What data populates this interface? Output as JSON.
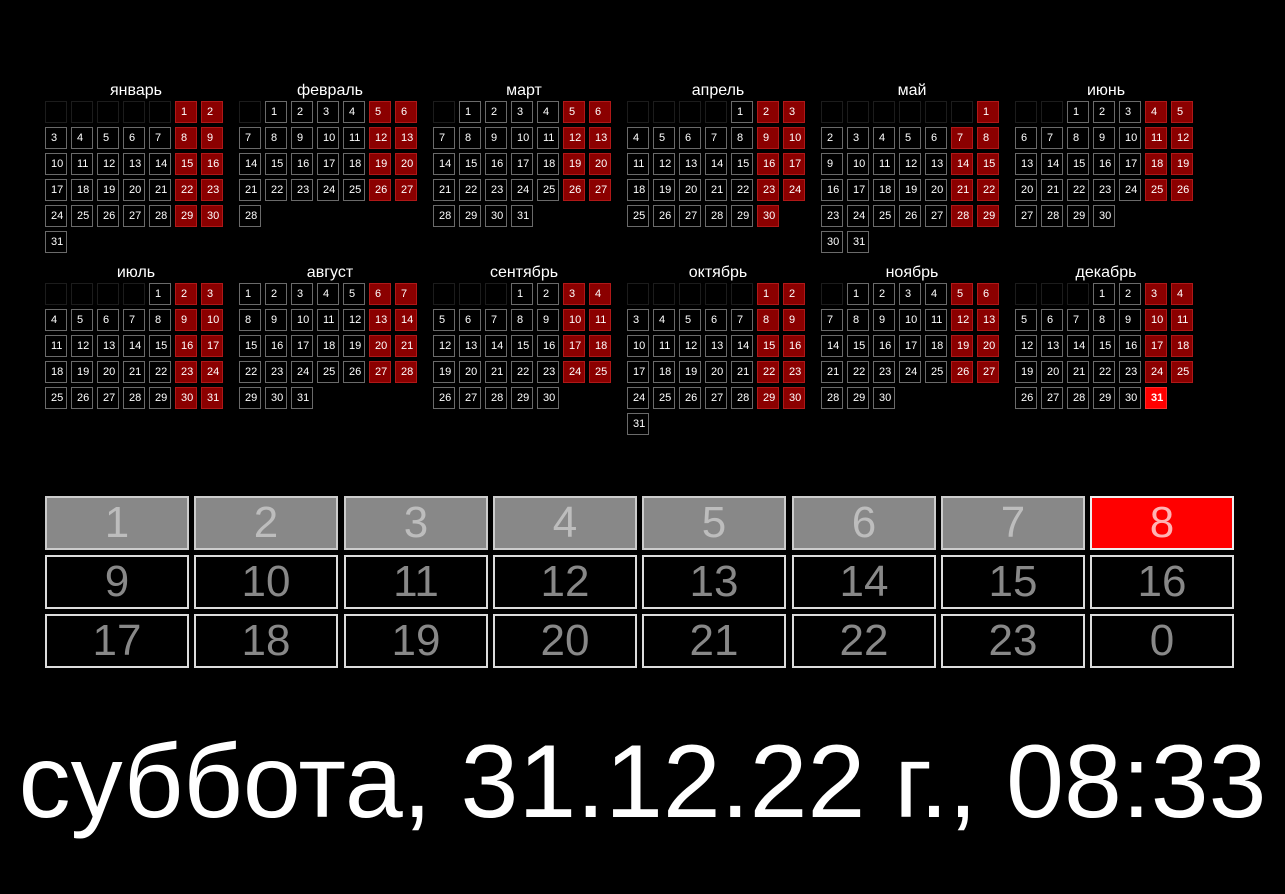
{
  "calendar": {
    "year": 2022,
    "today": {
      "month": 12,
      "day": 31
    },
    "month_names": [
      "январь",
      "февраль",
      "март",
      "апрель",
      "май",
      "июнь",
      "июль",
      "август",
      "сентябрь",
      "октябрь",
      "ноябрь",
      "декабрь"
    ]
  },
  "hours": {
    "current_hour": 8,
    "labels": [
      "1",
      "2",
      "3",
      "4",
      "5",
      "6",
      "7",
      "8",
      "9",
      "10",
      "11",
      "12",
      "13",
      "14",
      "15",
      "16",
      "17",
      "18",
      "19",
      "20",
      "21",
      "22",
      "23",
      "0"
    ]
  },
  "datetime_text": "суббота, 31.12.22 г., 08:33",
  "colors": {
    "background": "#000000",
    "weekend": "#8b0000",
    "today": "#ff0000",
    "past_hour": "#888888",
    "current_hour": "#ff0000"
  }
}
